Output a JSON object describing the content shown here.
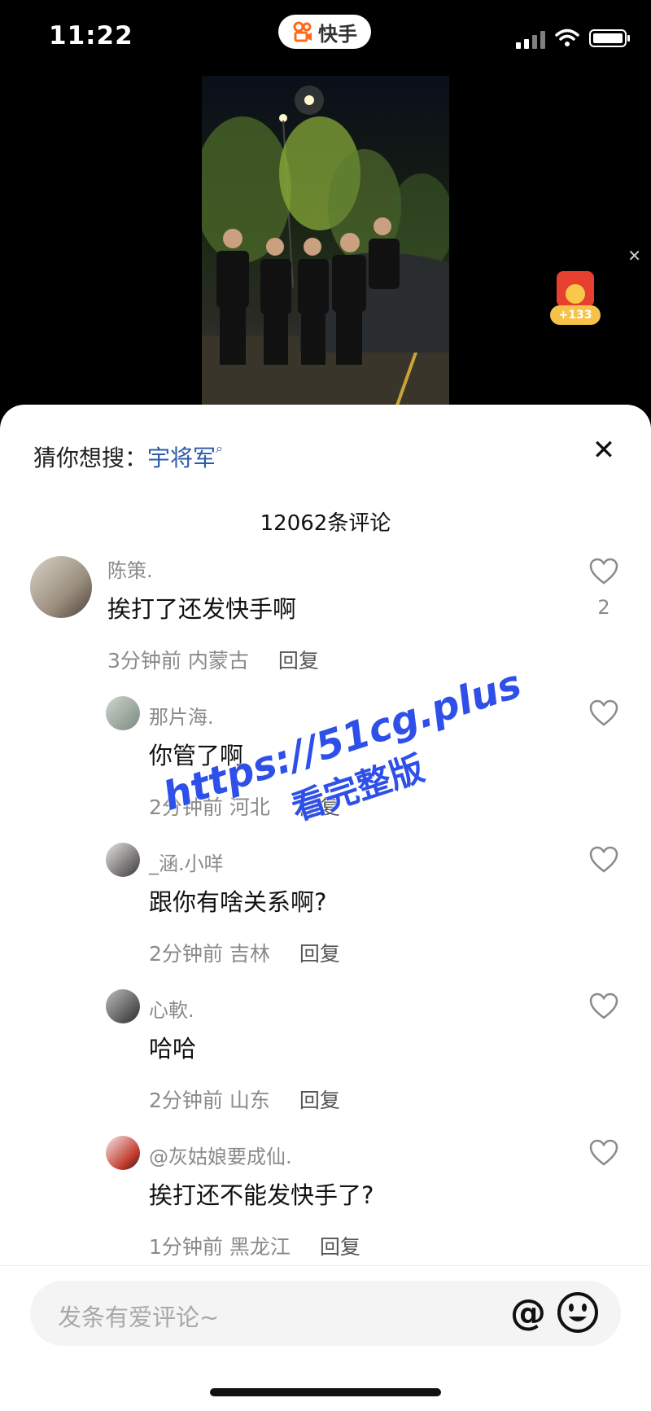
{
  "status_bar": {
    "time": "11:22",
    "app_badge": "快手"
  },
  "video": {
    "reward_count": "+133"
  },
  "search_suggest": {
    "prefix": "猜你想搜：",
    "keyword": "宇将军"
  },
  "comment_count": "12062条评论",
  "comments": [
    {
      "user": "陈策.",
      "text": "挨打了还发快手啊",
      "time": "3分钟前",
      "region": "内蒙古",
      "reply": "回复",
      "likes": "2"
    },
    {
      "user": "那片海.",
      "text": "你管了啊",
      "time": "2分钟前",
      "region": "河北",
      "reply": "回复"
    },
    {
      "user": "_涵.小咩",
      "text": "跟你有啥关系啊?",
      "time": "2分钟前",
      "region": "吉林",
      "reply": "回复"
    },
    {
      "user": "心軟.",
      "text": "哈哈",
      "time": "2分钟前",
      "region": "山东",
      "reply": "回复"
    },
    {
      "user": "@灰姑娘要成仙.",
      "text": "挨打还不能发快手了?",
      "time": "1分钟前",
      "region": "黑龙江",
      "reply": "回复"
    }
  ],
  "watermark": {
    "line1": "https://51cg.plus",
    "line2": "看完整版"
  },
  "composer": {
    "placeholder": "发条有爱评论~"
  },
  "colors": {
    "accent": "#2d5aa8",
    "brand": "#ff6a1a",
    "watermark": "#2f50e8"
  },
  "icons": [
    "signal-icon",
    "wifi-icon",
    "battery-icon",
    "heart-icon",
    "at-icon",
    "emoji-icon",
    "close-icon",
    "search-icon"
  ]
}
